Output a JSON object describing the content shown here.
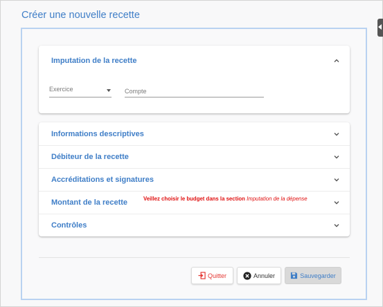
{
  "dialog": {
    "title": "Créer une nouvelle recette"
  },
  "panel_imputation": {
    "title": "Imputation de la recette",
    "expanded": true,
    "exercice_label": "Exercice",
    "compte_placeholder": "Compte"
  },
  "sections": [
    {
      "title": "Informations descriptives"
    },
    {
      "title": "Débiteur de la recette"
    },
    {
      "title": "Accréditations et signatures"
    },
    {
      "title": "Montant de la recette"
    },
    {
      "title": "Contrôles"
    }
  ],
  "warning": {
    "text_bold": "Veillez choisir le budget dans la section ",
    "text_italic": "Imputation de la dépense"
  },
  "buttons": {
    "quit": "Quitter",
    "cancel": "Annuler",
    "save": "Sauvegarder"
  },
  "colors": {
    "accent": "#3f7ec7",
    "danger": "#e53935",
    "warning": "#e01010"
  }
}
